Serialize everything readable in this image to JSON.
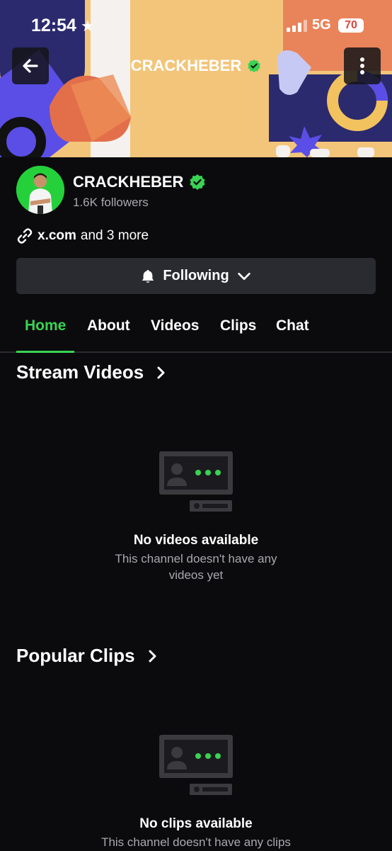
{
  "status_bar": {
    "time": "12:54",
    "network": "5G",
    "battery": "70"
  },
  "header": {
    "title": "CRACKHEBER"
  },
  "profile": {
    "name": "CRACKHEBER",
    "followers": "1.6K followers",
    "link_primary": "x.com",
    "link_more": "and 3 more",
    "follow_label": "Following"
  },
  "tabs": [
    {
      "label": "Home"
    },
    {
      "label": "About"
    },
    {
      "label": "Videos"
    },
    {
      "label": "Clips"
    },
    {
      "label": "Chat"
    }
  ],
  "sections": {
    "videos": {
      "title": "Stream Videos",
      "empty_title": "No videos available",
      "empty_text": "This channel doesn't have any videos yet"
    },
    "clips": {
      "title": "Popular Clips",
      "empty_title": "No clips available",
      "empty_text": "This channel doesn't have any clips"
    }
  },
  "colors": {
    "accent": "#39d353",
    "background": "#0b0b0d",
    "button": "#2a2b30",
    "banner": "#f3c57a"
  }
}
